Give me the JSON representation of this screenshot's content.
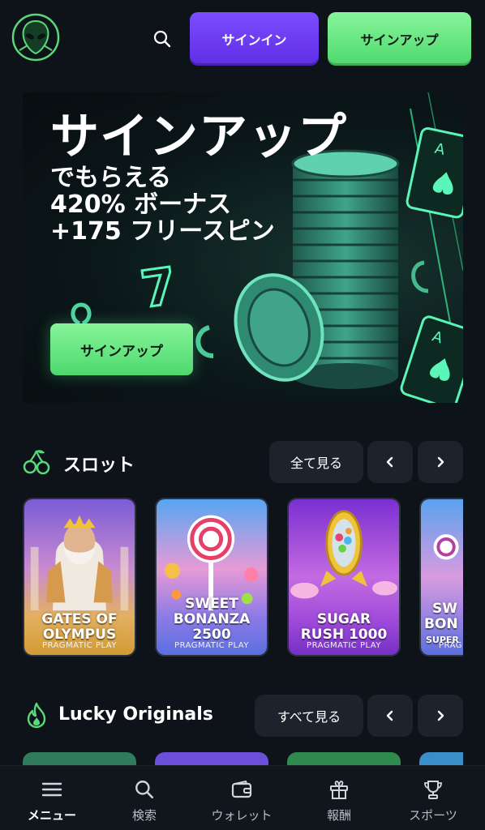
{
  "header": {
    "logo_icon": "alien-logo-icon",
    "search_icon": "search-icon",
    "signin_label": "サインイン",
    "signup_label": "サインアップ"
  },
  "hero": {
    "title": "サインアップ",
    "line1": "でもらえる",
    "line2": "420% ボーナス",
    "line3": "+175 フリースピン",
    "cta_label": "サインアップ"
  },
  "slots": {
    "icon": "cherries-icon",
    "title": "スロット",
    "view_all": "全て見る",
    "games": [
      {
        "name": "GATES OF OLYMPUS",
        "line1": "GATES OF",
        "line2": "OLYMPUS",
        "provider": "PRAGMATIC PLAY"
      },
      {
        "name": "SWEET BONANZA 2500",
        "line1": "SWEET",
        "line2": "BONANZA",
        "line3": "2500",
        "provider": "PRAGMATIC PLAY"
      },
      {
        "name": "SUGAR RUSH 1000",
        "line1": "SUGAR",
        "line2": "RUSH 1000",
        "provider": "PRAGMATIC PLAY"
      },
      {
        "name": "SWEET BONANZA SUPER",
        "line1": "SW",
        "line2": "BON",
        "line3": "SUPER",
        "provider": "PRAG"
      }
    ]
  },
  "originals": {
    "icon": "flame-icon",
    "title": "Lucky Originals",
    "view_all": "すべて見る"
  },
  "bottom_nav": [
    {
      "label": "メニュー",
      "icon": "menu-icon",
      "active": true
    },
    {
      "label": "検索",
      "icon": "search-icon",
      "active": false
    },
    {
      "label": "ウォレット",
      "icon": "wallet-icon",
      "active": false
    },
    {
      "label": "報酬",
      "icon": "gift-icon",
      "active": false
    },
    {
      "label": "スポーツ",
      "icon": "trophy-icon",
      "active": false
    }
  ],
  "colors": {
    "background": "#0e131a",
    "signin_purple": "#6a3cf2",
    "signup_green": "#6ee887",
    "card_bg": "#1d232c"
  }
}
